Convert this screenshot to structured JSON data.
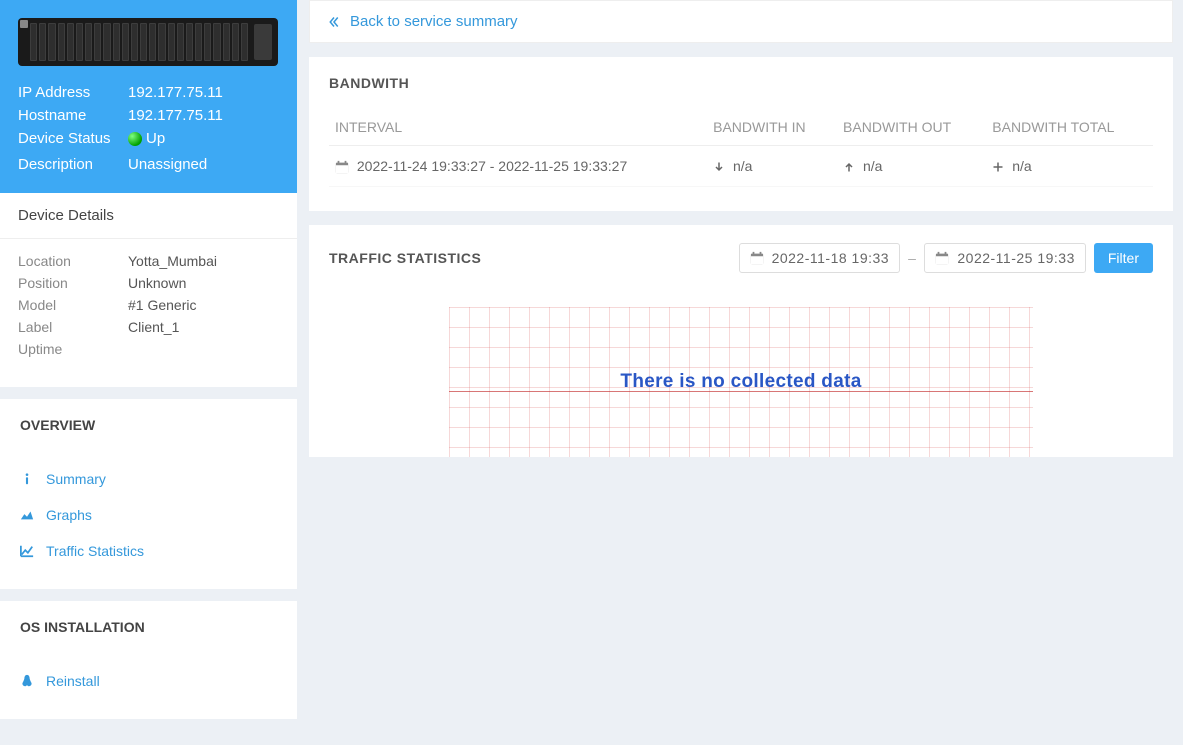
{
  "back_link": "Back to service summary",
  "server": {
    "ip_label": "IP Address",
    "ip": "192.177.75.11",
    "hostname_label": "Hostname",
    "hostname": "192.177.75.11",
    "status_label": "Device Status",
    "status": "Up",
    "description_label": "Description",
    "description": "Unassigned"
  },
  "device_details": {
    "title": "Device Details",
    "location_label": "Location",
    "location": "Yotta_Mumbai",
    "position_label": "Position",
    "position": "Unknown",
    "model_label": "Model",
    "model": "#1 Generic",
    "label_label": "Label",
    "label": "Client_1",
    "uptime_label": "Uptime",
    "uptime": ""
  },
  "overview": {
    "title": "OVERVIEW",
    "items": [
      "Summary",
      "Graphs",
      "Traffic Statistics"
    ]
  },
  "os_installation": {
    "title": "OS INSTALLATION",
    "items": [
      "Reinstall"
    ]
  },
  "bandwidth": {
    "title": "BANDWITH",
    "columns": [
      "INTERVAL",
      "BANDWITH IN",
      "BANDWITH OUT",
      "BANDWITH TOTAL"
    ],
    "row": {
      "interval": "2022-11-24 19:33:27 - 2022-11-25 19:33:27",
      "in": "n/a",
      "out": "n/a",
      "total": "n/a"
    }
  },
  "traffic": {
    "title": "TRAFFIC STATISTICS",
    "from": "2022-11-18 19:33",
    "to": "2022-11-25 19:33",
    "filter_label": "Filter",
    "no_data": "There is no collected data"
  }
}
